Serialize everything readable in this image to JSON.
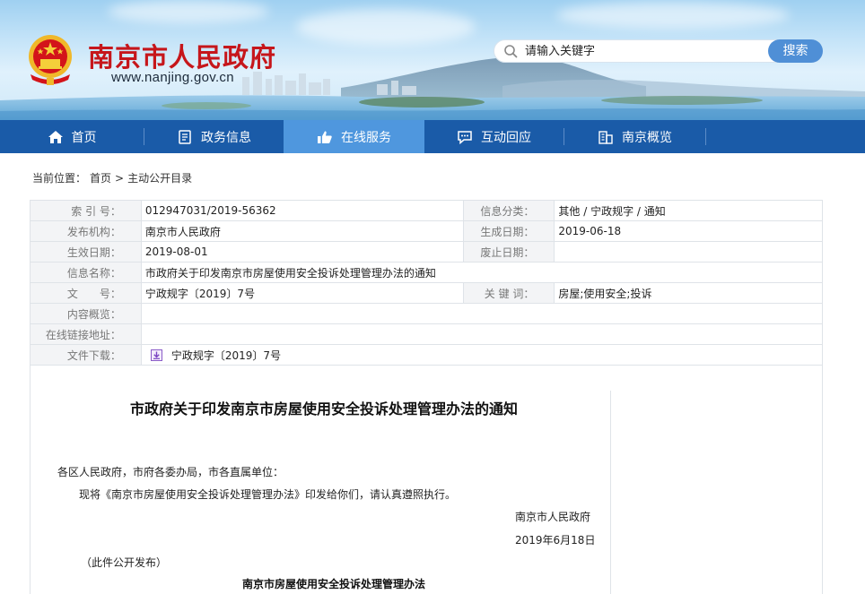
{
  "header": {
    "site_title": "南京市人民政府",
    "site_url": "www.nanjing.gov.cn",
    "search_placeholder": "请输入关键字",
    "search_button": "搜索"
  },
  "nav": {
    "items": [
      {
        "label": "首页",
        "icon": "home-icon"
      },
      {
        "label": "政务信息",
        "icon": "document-icon"
      },
      {
        "label": "在线服务",
        "icon": "thumbs-up-icon",
        "active": true
      },
      {
        "label": "互动回应",
        "icon": "chat-icon"
      },
      {
        "label": "南京概览",
        "icon": "building-icon"
      }
    ],
    "colors": {
      "bar": "#1a5ba8",
      "active": "#4f97de"
    }
  },
  "breadcrumb": {
    "prefix": "当前位置：",
    "home": "首页",
    "separator": ">",
    "current": "主动公开目录"
  },
  "info": {
    "index_label": "索 引 号：",
    "index_value": "012947031/2019-56362",
    "category_label": "信息分类：",
    "category_value": "其他 / 宁政规字 / 通知",
    "publisher_label": "发布机构：",
    "publisher_value": "南京市人民政府",
    "created_label": "生成日期：",
    "created_value": "2019-06-18",
    "effective_label": "生效日期：",
    "effective_value": "2019-08-01",
    "expiry_label": "废止日期：",
    "expiry_value": "",
    "name_label": "信息名称：",
    "name_value": "市政府关于印发南京市房屋使用安全投诉处理管理办法的通知",
    "docno_label": "文　　号：",
    "docno_value": "宁政规字〔2019〕7号",
    "keywords_label": "关 键 词：",
    "keywords_value": "房屋;使用安全;投诉",
    "summary_label": "内容概览：",
    "summary_value": "",
    "link_label": "在线链接地址：",
    "link_value": "",
    "download_label": "文件下载：",
    "download_value": "宁政规字〔2019〕7号"
  },
  "article": {
    "title": "市政府关于印发南京市房屋使用安全投诉处理管理办法的通知",
    "salutation": "各区人民政府，市府各委办局，市各直属单位：",
    "body": "现将《南京市房屋使用安全投诉处理管理办法》印发给你们，请认真遵照执行。",
    "signature": "南京市人民政府",
    "date": "2019年6月18日",
    "note": "（此件公开发布）",
    "attachment_title": "南京市房屋使用安全投诉处理管理办法"
  }
}
